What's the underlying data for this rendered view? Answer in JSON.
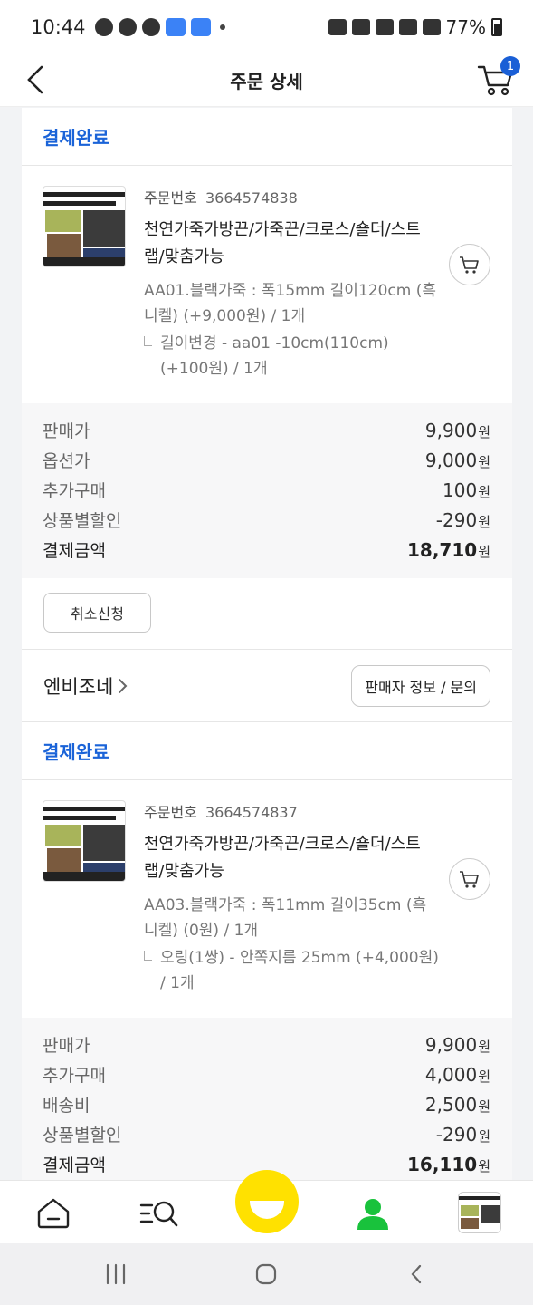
{
  "status_bar": {
    "time": "10:44",
    "battery": "77%"
  },
  "header": {
    "title": "주문 상세",
    "cart_count": "1"
  },
  "orders": [
    {
      "status": "결제완료",
      "order_label": "주문번호",
      "order_number": "3664574838",
      "product_name": "천연가죽가방끈/가죽끈/크로스/숄더/스트랩/맞춤가능",
      "option": "AA01.블랙가죽 : 폭15mm 길이120cm (흑니켈) (+9,000원) / 1개",
      "sub_option": "길이변경 - aa01 -10cm(110cm) (+100원) / 1개",
      "prices": [
        {
          "label": "판매가",
          "value": "9,900",
          "unit": "원"
        },
        {
          "label": "옵션가",
          "value": "9,000",
          "unit": "원"
        },
        {
          "label": "추가구매",
          "value": "100",
          "unit": "원"
        },
        {
          "label": "상품별할인",
          "value": "-290",
          "unit": "원"
        },
        {
          "label": "결제금액",
          "value": "18,710",
          "unit": "원"
        }
      ],
      "cancel_label": "취소신청"
    },
    {
      "status": "결제완료",
      "order_label": "주문번호",
      "order_number": "3664574837",
      "product_name": "천연가죽가방끈/가죽끈/크로스/숄더/스트랩/맞춤가능",
      "option": "AA03.블랙가죽 : 폭11mm 길이35cm (흑니켈) (0원) / 1개",
      "sub_option": "오링(1쌍) - 안쪽지름 25mm (+4,000원) / 1개",
      "prices": [
        {
          "label": "판매가",
          "value": "9,900",
          "unit": "원"
        },
        {
          "label": "추가구매",
          "value": "4,000",
          "unit": "원"
        },
        {
          "label": "배송비",
          "value": "2,500",
          "unit": "원"
        },
        {
          "label": "상품별할인",
          "value": "-290",
          "unit": "원"
        },
        {
          "label": "결제금액",
          "value": "16,110",
          "unit": "원"
        }
      ]
    }
  ],
  "seller": {
    "name": "엔비조네",
    "info_button": "판매자 정보 / 문의"
  },
  "icons": {
    "back": "chevron-left-icon",
    "cart": "cart-icon",
    "home": "home-icon",
    "search_menu": "search-menu-icon",
    "smile": "smile-icon",
    "person": "person-icon"
  },
  "colors": {
    "accent": "#1a63d8",
    "smile": "#ffe100",
    "person": "#19c23c",
    "badge": "#1a5fd6"
  }
}
